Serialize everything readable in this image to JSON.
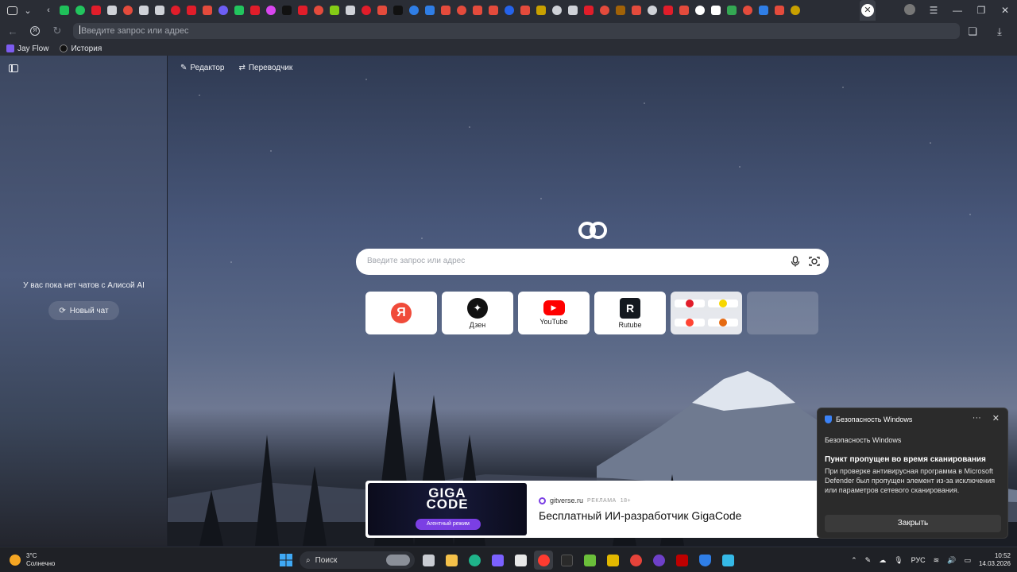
{
  "address_bar": {
    "placeholder": "Введите запрос или адрес"
  },
  "bookmarks": [
    {
      "label": "Jay Flow"
    },
    {
      "label": "История"
    }
  ],
  "tools": {
    "editor": "Редактор",
    "translator": "Переводчик"
  },
  "alice": {
    "empty_text": "У вас пока нет чатов с Алисой AI",
    "new_chat": "Новый чат"
  },
  "search": {
    "placeholder": "Введите запрос или адрес"
  },
  "tiles": [
    {
      "label": "",
      "icon": "yandex-icon",
      "color": "#f04b3a"
    },
    {
      "label": "Дзен",
      "icon": "dzen-icon",
      "color": "#111111"
    },
    {
      "label": "YouTube",
      "icon": "youtube-icon",
      "color": "#ff0000"
    },
    {
      "label": "Rutube",
      "icon": "rutube-icon",
      "color": "#14191f"
    }
  ],
  "ad": {
    "brand_line1": "GIGA",
    "brand_line2": "CODE",
    "pill": "Агентный режим",
    "source": "gitverse.ru",
    "tag": "РЕКЛАМА",
    "age": "18+",
    "title": "Бесплатный ИИ-разработчик GigaCode"
  },
  "toast": {
    "header": "Безопасность Windows",
    "app": "Безопасность Windows",
    "title": "Пункт пропущен во время сканирования",
    "body": "При проверке антивирусная программа в Microsoft Defender был пропущен элемент из-за исключения или параметров сетевого сканирования.",
    "button": "Закрыть"
  },
  "taskbar": {
    "temp": "3°C",
    "weather": "Солнечно",
    "search": "Поиск",
    "lang": "РУС",
    "time": "10:52",
    "date": "14.03.2026"
  }
}
